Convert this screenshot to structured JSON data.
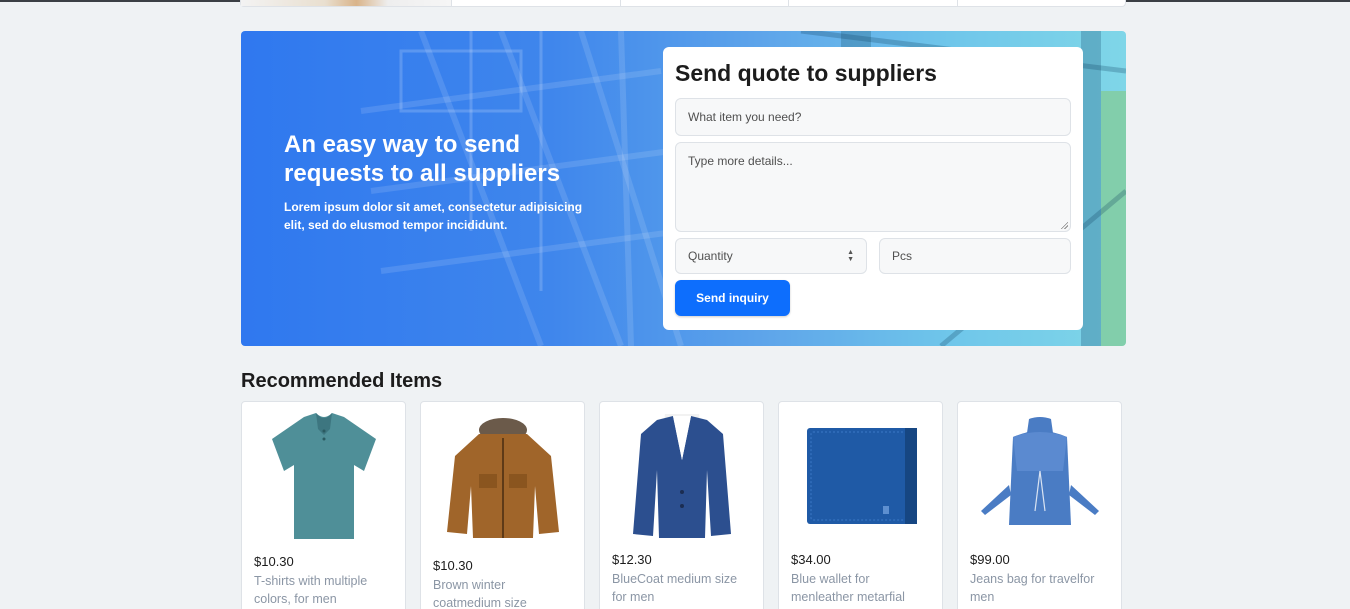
{
  "banner": {
    "title": "An easy way to send requests to all suppliers",
    "subtitle": "Lorem ipsum dolor sit amet, consectetur adipisicing elit, sed do elusmod tempor incididunt."
  },
  "quote": {
    "title": "Send quote to suppliers",
    "item_placeholder": "What item you need?",
    "details_placeholder": "Type more details...",
    "quantity_placeholder": "Quantity",
    "unit_placeholder": "Pcs",
    "send_label": "Send inquiry"
  },
  "recommended": {
    "title": "Recommended Items",
    "items": [
      {
        "price": "$10.30",
        "name": "T-shirts with multiple colors, for men",
        "icon": "tshirt-image",
        "color": "#4f8f98"
      },
      {
        "price": "$10.30",
        "name": "Brown winter coatmedium size",
        "icon": "jacket-image",
        "color": "#a0652a"
      },
      {
        "price": "$12.30",
        "name": "BlueCoat medium size for men",
        "icon": "blazer-image",
        "color": "#2c4f8f"
      },
      {
        "price": "$34.00",
        "name": "Blue wallet for menleather metarfial",
        "icon": "wallet-image",
        "color": "#1f5aa6"
      },
      {
        "price": "$99.00",
        "name": "Jeans bag for travelfor men",
        "icon": "backpack-image",
        "color": "#4a7cc4"
      }
    ]
  }
}
